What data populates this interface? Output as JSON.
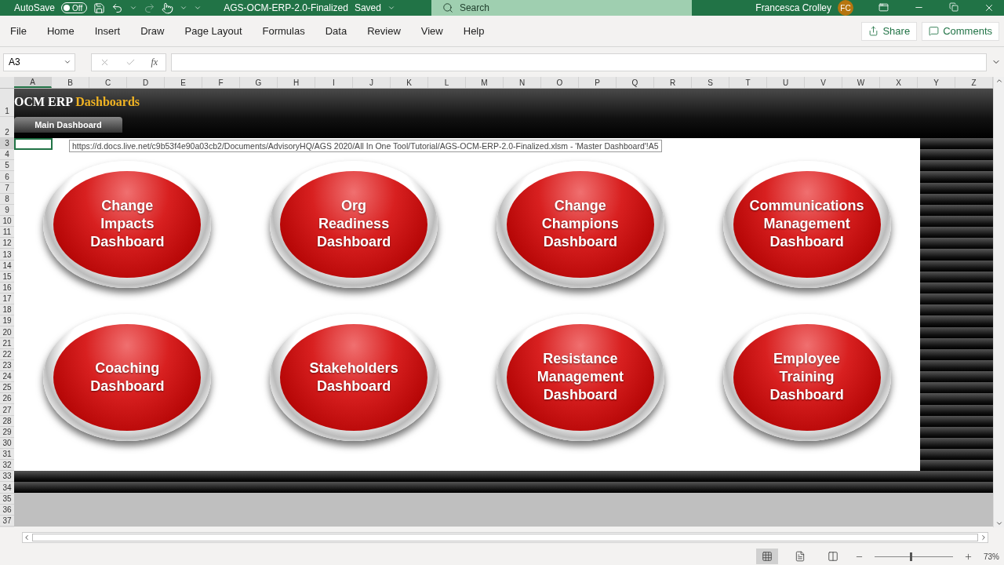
{
  "title_bar": {
    "autosave": {
      "label": "AutoSave",
      "on": false,
      "state_label": "Off"
    },
    "document_title": "AGS-OCM-ERP-2.0-Finalized",
    "save_status": "Saved",
    "search": {
      "placeholder": "Search"
    },
    "user_name": "Francesca Crolley",
    "user_initials": "FC"
  },
  "ribbon_tabs": [
    "File",
    "Home",
    "Insert",
    "Draw",
    "Page Layout",
    "Formulas",
    "Data",
    "Review",
    "View",
    "Help"
  ],
  "ribbon_actions": [
    {
      "kind": "share",
      "label": "Share"
    },
    {
      "kind": "comments",
      "label": "Comments"
    }
  ],
  "formula_bar": {
    "name_box": "A3",
    "function_label": "fx"
  },
  "columns": [
    "A",
    "B",
    "C",
    "D",
    "E",
    "F",
    "G",
    "H",
    "I",
    "J",
    "K",
    "L",
    "M",
    "N",
    "O",
    "P",
    "Q",
    "R",
    "S",
    "T",
    "U",
    "V",
    "W",
    "X",
    "Y",
    "Z"
  ],
  "rows": [
    "1",
    "2",
    "3",
    "4",
    "5",
    "6",
    "7",
    "8",
    "9",
    "10",
    "11",
    "12",
    "13",
    "14",
    "15",
    "16",
    "17",
    "18",
    "19",
    "20",
    "21",
    "22",
    "23",
    "24",
    "25",
    "26",
    "27",
    "28",
    "29",
    "30",
    "31",
    "32",
    "33",
    "34",
    "35",
    "36",
    "37"
  ],
  "sheet": {
    "title": "OCM ERP",
    "title_highlight": "Dashboards",
    "nav_button": "Main Dashboard",
    "hyperlink_tooltip": "https://d.docs.live.net/c9b53f4e90a03cb2/Documents/AdvisoryHQ/AGS 2020/All In One Tool/Tutorial/AGS-OCM-ERP-2.0-Finalized.xlsm - 'Master Dashboard'!A5",
    "dashboards": [
      {
        "lines": [
          "Change",
          "Impacts",
          "Dashboard"
        ]
      },
      {
        "lines": [
          "Org",
          "Readiness",
          "Dashboard"
        ]
      },
      {
        "lines": [
          "Change",
          "Champions",
          "Dashboard"
        ]
      },
      {
        "lines": [
          "Communications",
          "Management",
          "Dashboard"
        ]
      },
      {
        "lines": [
          "Coaching",
          "Dashboard"
        ]
      },
      {
        "lines": [
          "Stakeholders",
          "Dashboard"
        ]
      },
      {
        "lines": [
          "Resistance",
          "Management",
          "Dashboard"
        ]
      },
      {
        "lines": [
          "Employee",
          "Training",
          "Dashboard"
        ]
      }
    ]
  },
  "status_bar": {
    "views": [
      {
        "kind": "normal",
        "selected": true
      },
      {
        "kind": "page-layout",
        "selected": false
      },
      {
        "kind": "page-break",
        "selected": false
      }
    ],
    "zoom": "73%",
    "zoom_slider": {
      "level": 0.45
    }
  }
}
